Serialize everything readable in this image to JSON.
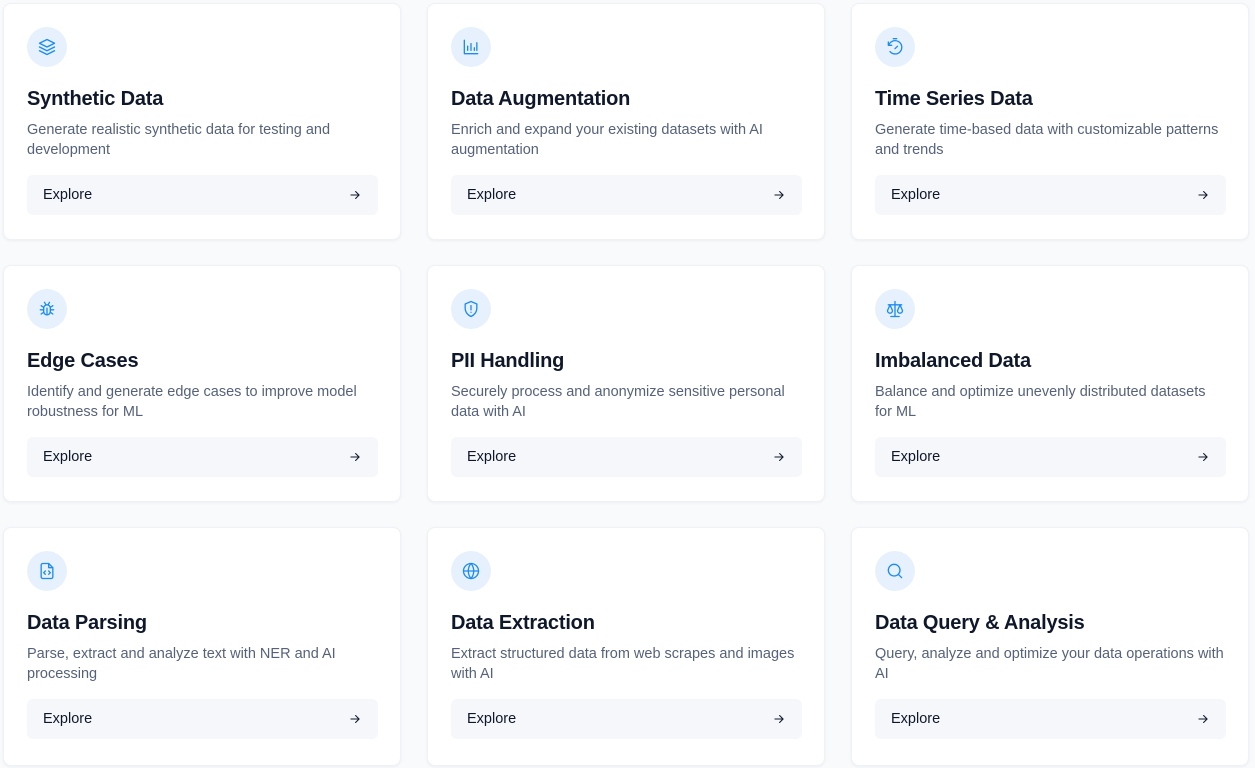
{
  "cards": [
    {
      "title": "Synthetic Data",
      "description": "Generate realistic synthetic data for testing and development",
      "button_label": "Explore",
      "icon": "layers-icon"
    },
    {
      "title": "Data Augmentation",
      "description": "Enrich and expand your existing datasets with AI augmentation",
      "button_label": "Explore",
      "icon": "bar-chart-icon"
    },
    {
      "title": "Time Series Data",
      "description": "Generate time-based data with customizable patterns and trends",
      "button_label": "Explore",
      "icon": "timer-reset-icon"
    },
    {
      "title": "Edge Cases",
      "description": "Identify and generate edge cases to improve model robustness for ML",
      "button_label": "Explore",
      "icon": "bug-icon"
    },
    {
      "title": "PII Handling",
      "description": "Securely process and anonymize sensitive personal data with AI",
      "button_label": "Explore",
      "icon": "shield-alert-icon"
    },
    {
      "title": "Imbalanced Data",
      "description": "Balance and optimize unevenly distributed datasets for ML",
      "button_label": "Explore",
      "icon": "scale-icon"
    },
    {
      "title": "Data Parsing",
      "description": "Parse, extract and analyze text with NER and AI processing",
      "button_label": "Explore",
      "icon": "file-code-icon"
    },
    {
      "title": "Data Extraction",
      "description": "Extract structured data from web scrapes and images with AI",
      "button_label": "Explore",
      "icon": "globe-icon"
    },
    {
      "title": "Data Query & Analysis",
      "description": "Query, analyze and optimize your data operations with AI",
      "button_label": "Explore",
      "icon": "search-icon"
    }
  ],
  "colors": {
    "accent": "#1d8cf0",
    "icon_background": "#e6f1fd",
    "card_background": "#ffffff",
    "page_background": "#f8fafc",
    "button_background": "#f5f7fa"
  }
}
